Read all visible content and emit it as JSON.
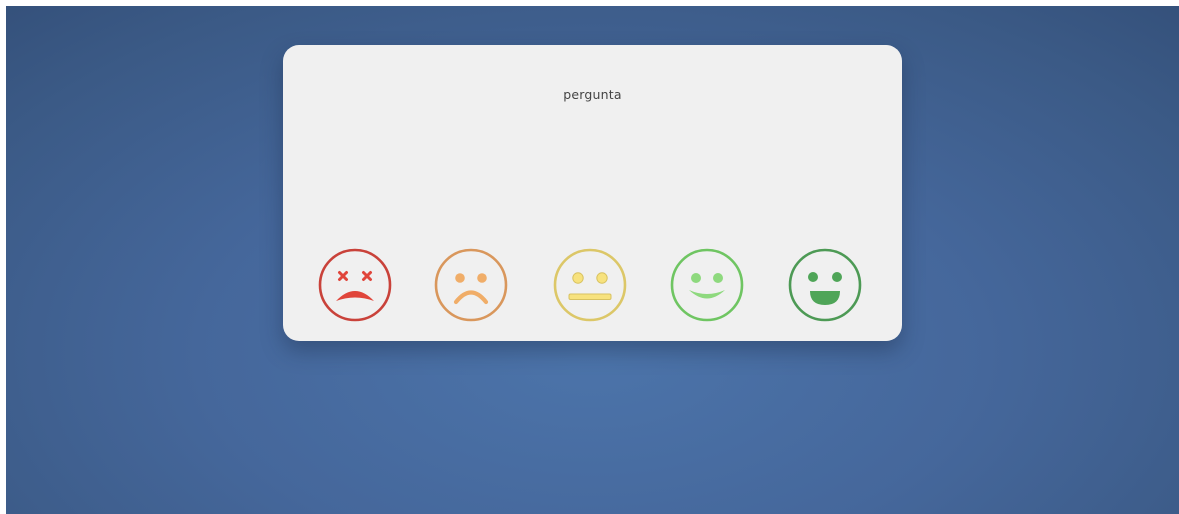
{
  "page": {
    "background_color": "#45679b"
  },
  "card": {
    "question": "pergunta"
  },
  "rating": {
    "options": [
      {
        "name": "very-dissatisfied",
        "icon": "dead-face-icon",
        "color": "#e0453b",
        "stroke": "#c9423a"
      },
      {
        "name": "dissatisfied",
        "icon": "sad-face-icon",
        "color": "#f0ad68",
        "stroke": "#d9975c"
      },
      {
        "name": "neutral",
        "icon": "neutral-face-icon",
        "color": "#f7e27e",
        "stroke": "#dcc768"
      },
      {
        "name": "satisfied",
        "icon": "smile-face-icon",
        "color": "#8ed97e",
        "stroke": "#6fc562"
      },
      {
        "name": "very-satisfied",
        "icon": "grin-face-icon",
        "color": "#4fa558",
        "stroke": "#4d9a55"
      }
    ]
  }
}
